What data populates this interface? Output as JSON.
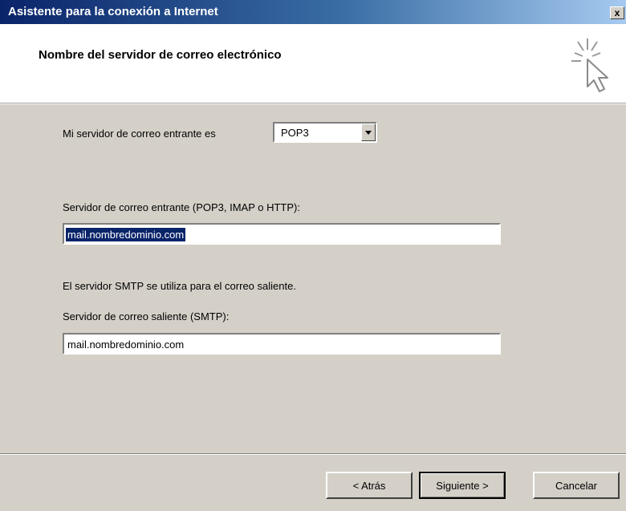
{
  "window": {
    "title": "Asistente para la conexión a Internet",
    "close_label": "x"
  },
  "header": {
    "title": "Nombre del servidor de correo electrónico",
    "icon": "wizard-cursor-icon"
  },
  "incoming_type": {
    "label": "Mi servidor de correo entrante es",
    "selected": "POP3"
  },
  "incoming_server": {
    "label": "Servidor de correo entrante (POP3, IMAP o HTTP):",
    "value": "mail.nombredominio.com"
  },
  "smtp_note": "El servidor SMTP se utiliza para el correo saliente.",
  "outgoing_server": {
    "label": "Servidor de correo saliente (SMTP):",
    "value": "mail.nombredominio.com"
  },
  "buttons": {
    "back": "< Atrás",
    "next": "Siguiente >",
    "cancel": "Cancelar"
  }
}
